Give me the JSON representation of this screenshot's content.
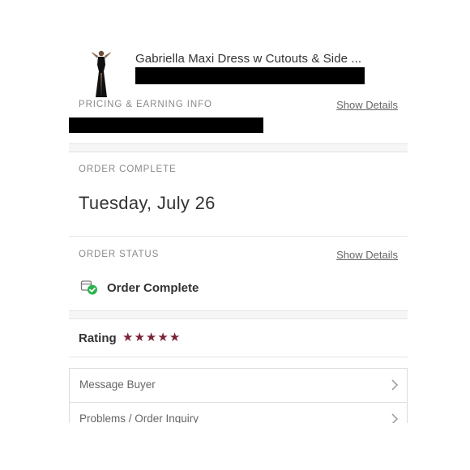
{
  "product": {
    "title": "Gabriella Maxi Dress w Cutouts & Side ..."
  },
  "pricing": {
    "label": "PRICING & EARNING INFO",
    "link": "Show Details"
  },
  "order_complete": {
    "label": "ORDER COMPLETE",
    "date": "Tuesday, July 26"
  },
  "order_status": {
    "label": "ORDER STATUS",
    "link": "Show Details",
    "status": "Order Complete"
  },
  "rating": {
    "label": "Rating",
    "stars": 5,
    "star_color": "#7a2236"
  },
  "actions": [
    {
      "label": "Message Buyer"
    },
    {
      "label": "Problems / Order Inquiry"
    }
  ],
  "colors": {
    "accent": "#7a2236",
    "status_check": "#2bb24c"
  }
}
